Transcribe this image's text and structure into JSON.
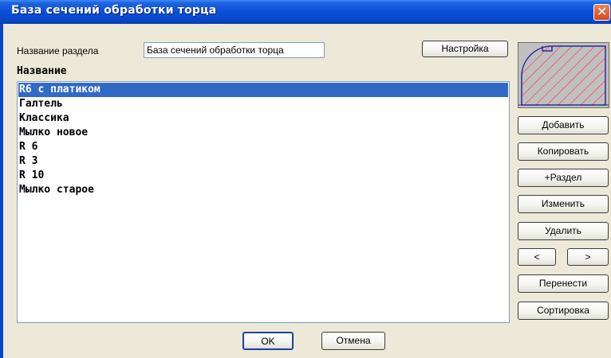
{
  "window": {
    "title": "База сечений обработки торца",
    "close_glyph": "✕"
  },
  "section": {
    "label": "Название раздела",
    "value": "База сечений обработки торца"
  },
  "buttons": {
    "settings": "Настройка",
    "add": "Добавить",
    "copy": "Копировать",
    "add_section": "+Раздел",
    "edit": "Изменить",
    "delete": "Удалить",
    "prev": "<",
    "next": ">",
    "move": "Перенести",
    "sort": "Сортировка",
    "ok": "OK",
    "cancel": "Отмена"
  },
  "list": {
    "header": "Название",
    "items": [
      "R6 с платиком",
      "Галтель",
      "Классика",
      "Мылко новое",
      "R 6",
      "R 3",
      "R 10",
      "Мылко старое"
    ],
    "selected_index": 0
  },
  "colors": {
    "title_bar": "#0a4fd6",
    "selection": "#316ac5",
    "preview_hatch": "#ff3030",
    "preview_fill": "#c0c0c0",
    "dialog_bg": "#ECE9D8"
  }
}
